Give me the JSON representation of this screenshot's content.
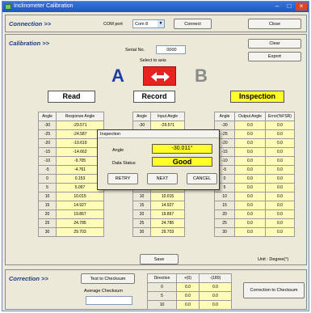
{
  "window": {
    "title": "Inclinometer Calibration",
    "minimize": "–",
    "maximize": "□",
    "close": "×"
  },
  "connection": {
    "title": "Connection >>",
    "com_label": "COM port",
    "com_value": "Com 8",
    "connect_label": "Connect",
    "close_label": "Close"
  },
  "calibration": {
    "title": "Calibration >>",
    "serial_label": "Serial No.",
    "serial_value": "0000",
    "axis_label": "Select to axis",
    "clear_label": "Clear",
    "export_label": "Export",
    "axis_a": "A",
    "axis_b": "B",
    "read_label": "Read",
    "record_label": "Record",
    "inspection_label": "Inspection",
    "read_headers": [
      "Angle",
      "Response Angle"
    ],
    "read_rows": [
      [
        "-30",
        "-29.571"
      ],
      [
        "-25",
        "-24.587"
      ],
      [
        "-20",
        "-19.619"
      ],
      [
        "-15",
        "-14.662"
      ],
      [
        "-10",
        "-9.705"
      ],
      [
        "-5",
        "-4.761"
      ],
      [
        "0",
        "0.153"
      ],
      [
        "5",
        "5.097"
      ],
      [
        "10",
        "10.015"
      ],
      [
        "15",
        "14.927"
      ],
      [
        "20",
        "19.867"
      ],
      [
        "25",
        "24.785"
      ],
      [
        "30",
        "29.703"
      ]
    ],
    "record_headers": [
      "Angle",
      "Input Angle"
    ],
    "record_rows": [
      [
        "-30",
        "-29.571"
      ],
      [
        "",
        ""
      ],
      [
        "",
        ""
      ],
      [
        "",
        ""
      ],
      [
        "",
        ""
      ],
      [
        "",
        ""
      ],
      [
        "",
        ""
      ],
      [
        "",
        ""
      ],
      [
        "10",
        "10.015"
      ],
      [
        "15",
        "14.927"
      ],
      [
        "20",
        "19.867"
      ],
      [
        "25",
        "24.785"
      ],
      [
        "30",
        "29.703"
      ]
    ],
    "inspection_headers": [
      "Angle",
      "Output Angle",
      "Error(%FSR)"
    ],
    "inspection_rows": [
      [
        "-30",
        "0.0",
        "0.0"
      ],
      [
        "-25",
        "0.0",
        "0.0"
      ],
      [
        "-20",
        "0.0",
        "0.0"
      ],
      [
        "-15",
        "0.0",
        "0.0"
      ],
      [
        "-10",
        "0.0",
        "0.0"
      ],
      [
        "-5",
        "0.0",
        "0.0"
      ],
      [
        "0",
        "0.0",
        "0.0"
      ],
      [
        "5",
        "0.0",
        "0.0"
      ],
      [
        "10",
        "0.0",
        "0.0"
      ],
      [
        "15",
        "0.0",
        "0.0"
      ],
      [
        "20",
        "0.0",
        "0.0"
      ],
      [
        "25",
        "0.0",
        "0.0"
      ],
      [
        "30",
        "0.0",
        "0.0"
      ]
    ],
    "save_label": "Save",
    "unit_label": "Unit : Degree(°)"
  },
  "dialog": {
    "title": "Inspection",
    "angle_label": "Angle",
    "angle_value": "-30.011°",
    "status_label": "Data Status",
    "status_value": "Good",
    "retry_label": "RETRY",
    "next_label": "NEXT",
    "cancel_label": "CANCEL"
  },
  "correction": {
    "title": "Correction >>",
    "test_label": "Test to Checksum",
    "avg_label": "Average Checksum",
    "avg_value": "",
    "headers": [
      "Direction",
      "+(0)",
      "-(180)"
    ],
    "rows": [
      [
        "0",
        "0.0",
        "0.0"
      ],
      [
        "5",
        "0.0",
        "0.0"
      ],
      [
        "10",
        "0.0",
        "0.0"
      ]
    ],
    "correction_label": "Correction to Checksum"
  },
  "colors": {
    "record_arrow_bg": "#e8231f",
    "inspection_head_bg": "#ffff2a",
    "axis_a": "#1d3fa5",
    "axis_b": "#8a8a8a",
    "value_cell": "#fffbb8"
  }
}
